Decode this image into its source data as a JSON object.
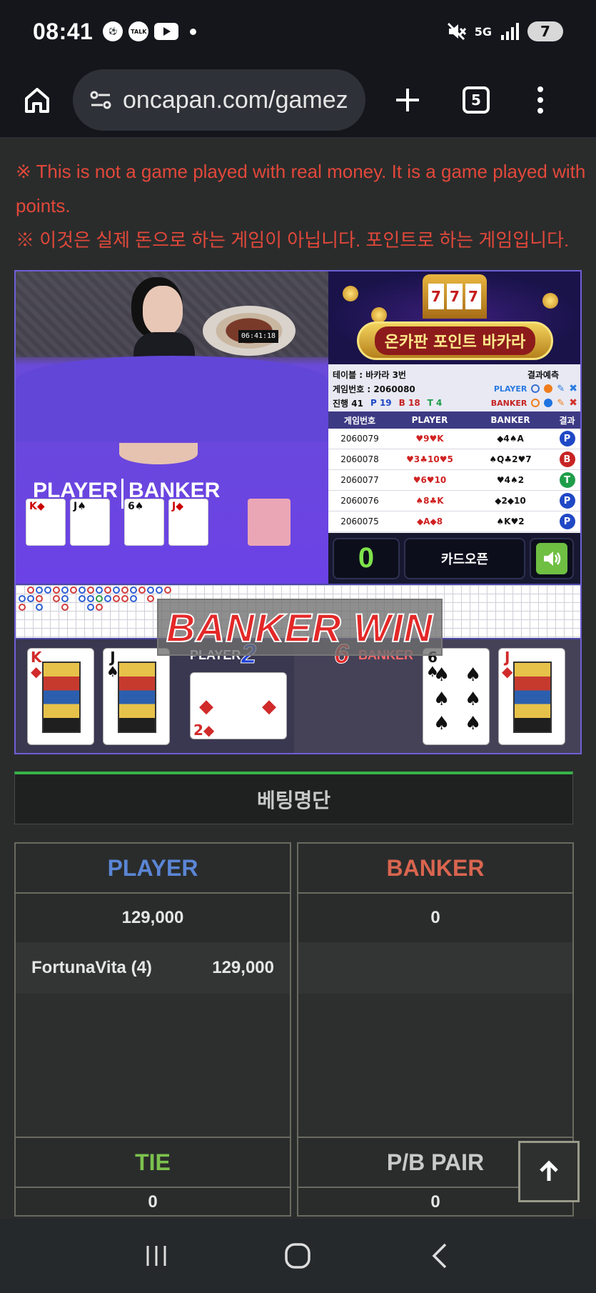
{
  "status_bar": {
    "time": "08:41",
    "network": "5G",
    "battery": "7",
    "left_icons": [
      "soccer-ball-icon",
      "talk-icon",
      "youtube-icon",
      "dot-icon"
    ],
    "talk_label": "TALK"
  },
  "browser": {
    "url": "oncapan.com/gamez",
    "tab_count": "5"
  },
  "notice": {
    "english": "※ This is not a game played with real money. It is a game played with points.",
    "korean": "※ 이것은 실제 돈으로 하는 게임이 아닙니다. 포인트로 하는 게임입니다."
  },
  "game": {
    "logo_text": "온카판 포인트 바카라",
    "slot_digits": [
      "7",
      "7",
      "7"
    ],
    "video": {
      "clock": "06:41:18",
      "player_label": "PLAYER",
      "banker_label": "BANKER"
    },
    "info": {
      "table": "테이블 : 바카라 3번",
      "game_number": "게임번호 : 2060080",
      "progress_label": "진행 41",
      "p_count": "P 19",
      "b_count": "B 18",
      "t_count": "T 4",
      "prediction_label": "결과예측",
      "player": "PLAYER",
      "banker": "BANKER"
    },
    "history": {
      "headers": [
        "게임번호",
        "PLAYER",
        "BANKER",
        "결과"
      ],
      "rows": [
        {
          "id": "2060079",
          "player": "♥9♥K",
          "banker": "◆4♠A",
          "result": "P"
        },
        {
          "id": "2060078",
          "player": "♥3♣10♥5",
          "banker": "♠Q♣2♥7",
          "result": "B"
        },
        {
          "id": "2060077",
          "player": "♥6♥10",
          "banker": "♥4♠2",
          "result": "T"
        },
        {
          "id": "2060076",
          "player": "♠8♣K",
          "banker": "◆2◆10",
          "result": "P"
        },
        {
          "id": "2060075",
          "player": "◆A◆8",
          "banker": "♠K♥2",
          "result": "P"
        }
      ]
    },
    "controls": {
      "countdown": "0",
      "card_open": "카드오픈"
    },
    "win_banner": "BANKER WIN",
    "result": {
      "player_label": "PLAYER",
      "player_score": "2",
      "banker_label": "BANKER",
      "banker_score": "6",
      "player_cards": [
        {
          "rank": "K",
          "suit": "◆"
        },
        {
          "rank": "J",
          "suit": "♠"
        },
        {
          "rank": "2",
          "suit": "◆"
        }
      ],
      "banker_cards": [
        {
          "rank": "6",
          "suit": "♠"
        },
        {
          "rank": "J",
          "suit": "◆"
        }
      ]
    }
  },
  "betting": {
    "title": "베팅명단",
    "player": {
      "label": "PLAYER",
      "total": "129,000",
      "entries": [
        {
          "name": "FortunaVita (4)",
          "amount": "129,000"
        }
      ]
    },
    "banker": {
      "label": "BANKER",
      "total": "0"
    },
    "tie": {
      "label": "TIE",
      "total": "0"
    },
    "pair": {
      "label": "P/B PAIR",
      "total": "0"
    }
  },
  "colors": {
    "player": "#5b86d6",
    "banker": "#d9654f",
    "tie": "#7cc24d",
    "notice": "#e2483a"
  }
}
